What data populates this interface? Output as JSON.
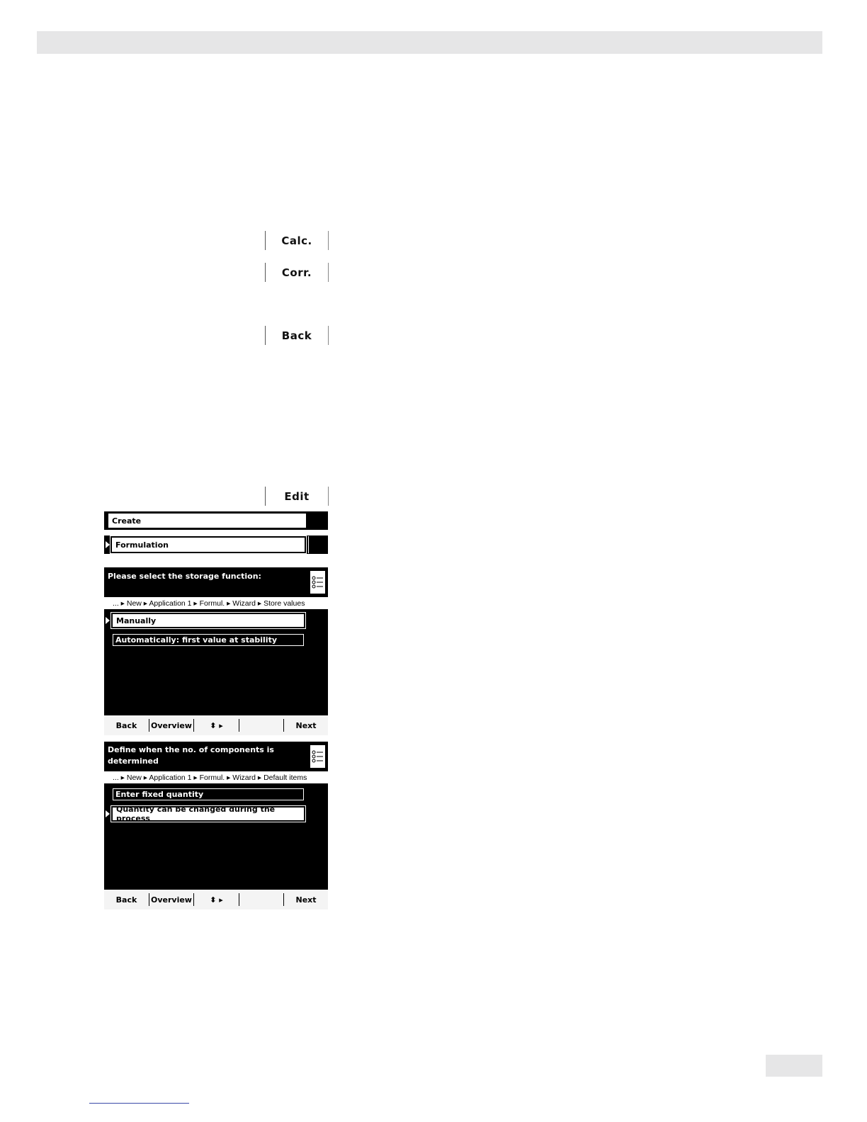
{
  "softkeys": {
    "calc": "Calc.",
    "corr": "Corr.",
    "back": "Back",
    "edit": "Edit"
  },
  "screen_create": {
    "create_label": "Create",
    "formulation_label": "Formulation"
  },
  "screen_storage": {
    "title": "Please select the storage function:",
    "breadcrumb": "...     ▸ New ▸ Application 1 ▸ Formul. ▸ Wizard ▸ Store values",
    "options": [
      "Manually",
      "Automatically: first value at stability"
    ],
    "softbar": {
      "back": "Back",
      "overview": "Overview",
      "arrows": "⬍ ▸",
      "next": "Next"
    }
  },
  "screen_components": {
    "title_line1": "Define when the no. of components is",
    "title_line2": "determined",
    "breadcrumb": "...     ▸ New ▸ Application 1 ▸ Formul. ▸ Wizard ▸ Default items",
    "options": [
      "Enter fixed quantity",
      "Quantity can be changed during the process"
    ],
    "softbar": {
      "back": "Back",
      "overview": "Overview",
      "arrows": "⬍ ▸",
      "next": "Next"
    }
  }
}
